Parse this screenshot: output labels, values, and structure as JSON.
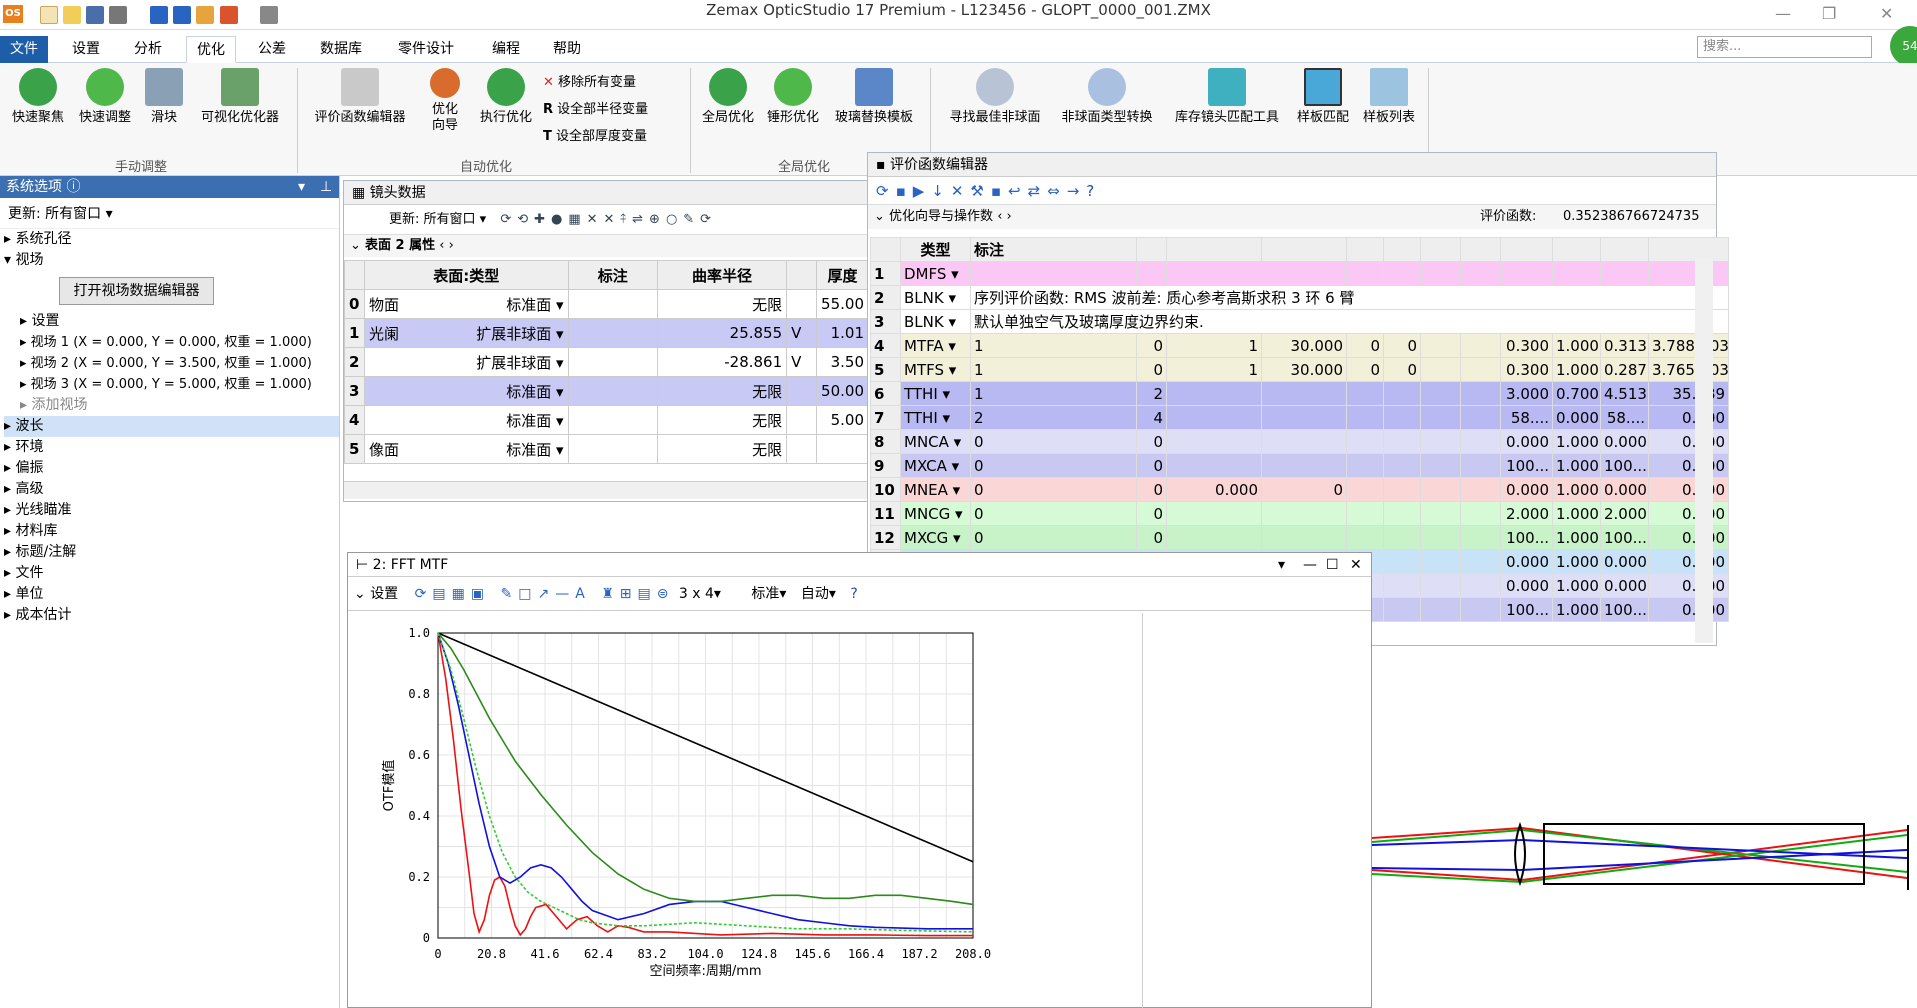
{
  "app": {
    "title": "Zemax OpticStudio 17    Premium - L123456 - GLOPT_0000_001.ZMX",
    "icon": "OS"
  },
  "tabs": [
    "文件",
    "设置",
    "分析",
    "优化",
    "公差",
    "数据库",
    "零件设计",
    "编程",
    "帮助"
  ],
  "search": {
    "placeholder": "搜索..."
  },
  "avatar": "54",
  "ribbon": {
    "manual": {
      "label": "手动调整",
      "buttons": [
        "快速聚焦",
        "快速调整",
        "滑块",
        "可视化优化器"
      ]
    },
    "auto": {
      "label": "自动优化",
      "buttons": [
        "评价函数编辑器",
        "优化\n向导",
        "执行优化"
      ],
      "small": [
        "移除所有变量",
        "设全部半径变量",
        "设全部厚度变量"
      ]
    },
    "global": {
      "label": "全局优化",
      "buttons": [
        "全局优化",
        "锤形优化",
        "玻璃替换模板"
      ]
    },
    "tools": {
      "buttons": [
        "寻找最佳非球面",
        "非球面类型转换",
        "库存镜头匹配工具",
        "样板匹配",
        "样板列表"
      ]
    }
  },
  "sidebar": {
    "title": "系统选项",
    "update": "更新: 所有窗口",
    "items": [
      "系统孔径",
      "视场"
    ],
    "button": "打开视场数据编辑器",
    "fields": [
      "设置",
      "视场 1 (X = 0.000, Y = 0.000, 权重 = 1.000)",
      "视场 2 (X = 0.000, Y = 3.500, 权重 = 1.000)",
      "视场 3 (X = 0.000, Y = 5.000, 权重 = 1.000)",
      "添加视场"
    ],
    "items2": [
      "波长",
      "环境",
      "偏振",
      "高级",
      "光线瞄准",
      "材料库",
      "标题/注解",
      "文件",
      "单位",
      "成本估计"
    ]
  },
  "lens": {
    "title": "镜头数据",
    "update": "更新: 所有窗口",
    "props": "表面 2 属性",
    "headers": [
      "",
      "表面:类型",
      "",
      "标注",
      "曲率半径",
      "",
      "厚度"
    ],
    "rows": [
      {
        "n": "0",
        "name": "物面",
        "type": "标准面",
        "r": "无限",
        "f": "",
        "t": "55.00"
      },
      {
        "n": "1",
        "name": "光阑",
        "type": "扩展非球面",
        "r": "25.855",
        "f": "V",
        "t": "1.01"
      },
      {
        "n": "2",
        "name": "",
        "type": "扩展非球面",
        "r": "-28.861",
        "f": "V",
        "t": "3.50"
      },
      {
        "n": "3",
        "name": "",
        "type": "标准面",
        "r": "无限",
        "f": "",
        "t": "50.00"
      },
      {
        "n": "4",
        "name": "",
        "type": "标准面",
        "r": "无限",
        "f": "",
        "t": "5.00"
      },
      {
        "n": "5",
        "name": "像面",
        "type": "标准面",
        "r": "无限",
        "f": "",
        "t": ""
      }
    ]
  },
  "merit": {
    "title": "评价函数编辑器",
    "wizard": "优化向导与操作数",
    "mf_label": "评价函数:",
    "mf_value": "0.352386766724735",
    "headers": [
      "",
      "类型",
      "标注"
    ],
    "rows": [
      {
        "n": "1",
        "type": "DMFS",
        "c": [
          "",
          "",
          "",
          "",
          "",
          "",
          "",
          "",
          "",
          "",
          "",
          ""
        ]
      },
      {
        "n": "2",
        "type": "BLNK",
        "span": "序列评价函数: RMS 波前差: 质心参考高斯求积 3 环 6 臂"
      },
      {
        "n": "3",
        "type": "BLNK",
        "span": "默认单独空气及玻璃厚度边界约束."
      },
      {
        "n": "4",
        "type": "MTFA",
        "c": [
          "1",
          "0",
          "1",
          "30.000",
          "0",
          "0",
          "",
          "",
          "0.300",
          "1.000",
          "0.313",
          "3.788E-03"
        ]
      },
      {
        "n": "5",
        "type": "MTFS",
        "c": [
          "1",
          "0",
          "1",
          "30.000",
          "0",
          "0",
          "",
          "",
          "0.300",
          "1.000",
          "0.287",
          "3.765E-03"
        ]
      },
      {
        "n": "6",
        "type": "TTHI",
        "c": [
          "1",
          "2",
          "",
          "",
          "",
          "",
          "",
          "",
          "3.000",
          "0.700",
          "4.513",
          "35.989"
        ]
      },
      {
        "n": "7",
        "type": "TTHI",
        "c": [
          "2",
          "4",
          "",
          "",
          "",
          "",
          "",
          "",
          "58....",
          "0.000",
          "58....",
          "0.000"
        ]
      },
      {
        "n": "8",
        "type": "MNCA",
        "c": [
          "0",
          "0",
          "",
          "",
          "",
          "",
          "",
          "",
          "0.000",
          "1.000",
          "0.000",
          "0.000"
        ]
      },
      {
        "n": "9",
        "type": "MXCA",
        "c": [
          "0",
          "0",
          "",
          "",
          "",
          "",
          "",
          "",
          "100...",
          "1.000",
          "100...",
          "0.000"
        ]
      },
      {
        "n": "10",
        "type": "MNEA",
        "c": [
          "0",
          "0",
          "0.000",
          "0",
          "",
          "",
          "",
          "",
          "0.000",
          "1.000",
          "0.000",
          "0.000"
        ]
      },
      {
        "n": "11",
        "type": "MNCG",
        "c": [
          "0",
          "0",
          "",
          "",
          "",
          "",
          "",
          "",
          "2.000",
          "1.000",
          "2.000",
          "0.000"
        ]
      },
      {
        "n": "12",
        "type": "MXCG",
        "c": [
          "0",
          "0",
          "",
          "",
          "",
          "",
          "",
          "",
          "100...",
          "1.000",
          "100...",
          "0.000"
        ]
      },
      {
        "n": "13",
        "type": "",
        "c": [
          "",
          "",
          "",
          "",
          "",
          "",
          "",
          "",
          "0.000",
          "1.000",
          "0.000",
          "0.000"
        ]
      },
      {
        "n": "14",
        "type": "",
        "c": [
          "",
          "",
          "",
          "",
          "",
          "",
          "",
          "",
          "0.000",
          "1.000",
          "0.000",
          "0.000"
        ]
      },
      {
        "n": "15",
        "type": "",
        "c": [
          "",
          "",
          "",
          "",
          "",
          "",
          "",
          "",
          "100...",
          "1.000",
          "100...",
          "0.000"
        ]
      }
    ]
  },
  "mtf": {
    "title": "2: FFT MTF",
    "settings": "设置",
    "layout": "3 x 4",
    "std": "标准",
    "auto": "自动"
  },
  "chart_data": {
    "type": "line",
    "xlabel": "空间频率:周期/mm",
    "ylabel": "OTF模值",
    "xticks": [
      "0",
      "20.8",
      "41.6",
      "62.4",
      "83.2",
      "104.0",
      "124.8",
      "145.6",
      "166.4",
      "187.2",
      "208.0"
    ],
    "yticks": [
      "0",
      "0.2",
      "0.4",
      "0.6",
      "0.8",
      "1.0"
    ],
    "xlim": [
      0,
      208
    ],
    "ylim": [
      0,
      1
    ],
    "colors": {
      "diffraction": "#000000",
      "red": "#ee1111",
      "blue": "#1111dd",
      "green": "#2a8a1a",
      "lgreen": "#33cc33"
    },
    "series": [
      {
        "color": "diffraction",
        "x": [
          0,
          208
        ],
        "y": [
          1,
          0.25
        ]
      },
      {
        "color": "red",
        "x": [
          0,
          3,
          6,
          9,
          12,
          14,
          16,
          18,
          20,
          22,
          24,
          26,
          28,
          30,
          32,
          34,
          36,
          38,
          42,
          46,
          50,
          54,
          58,
          62,
          66,
          70,
          74,
          80,
          90,
          100,
          110,
          130,
          150,
          170,
          190,
          208
        ],
        "y": [
          1,
          0.85,
          0.65,
          0.42,
          0.22,
          0.08,
          0.02,
          0.06,
          0.14,
          0.19,
          0.2,
          0.17,
          0.1,
          0.04,
          0.01,
          0.03,
          0.07,
          0.1,
          0.11,
          0.07,
          0.03,
          0.06,
          0.07,
          0.04,
          0.02,
          0.04,
          0.035,
          0.02,
          0.02,
          0.015,
          0.01,
          0.015,
          0.01,
          0.01,
          0.008,
          0.008
        ]
      },
      {
        "color": "blue",
        "x": [
          0,
          4,
          8,
          12,
          16,
          20,
          24,
          28,
          32,
          36,
          40,
          44,
          48,
          52,
          56,
          60,
          70,
          80,
          90,
          100,
          110,
          120,
          130,
          140,
          150,
          160,
          170,
          190,
          208
        ],
        "y": [
          1,
          0.9,
          0.76,
          0.6,
          0.44,
          0.3,
          0.2,
          0.18,
          0.2,
          0.23,
          0.24,
          0.23,
          0.2,
          0.16,
          0.12,
          0.09,
          0.06,
          0.08,
          0.11,
          0.12,
          0.12,
          0.1,
          0.08,
          0.06,
          0.05,
          0.04,
          0.035,
          0.03,
          0.03
        ]
      },
      {
        "color": "green",
        "x": [
          0,
          5,
          10,
          15,
          20,
          30,
          40,
          50,
          60,
          70,
          80,
          90,
          100,
          110,
          120,
          130,
          140,
          150,
          160,
          170,
          180,
          190,
          200,
          208
        ],
        "y": [
          1,
          0.95,
          0.88,
          0.8,
          0.72,
          0.58,
          0.47,
          0.37,
          0.28,
          0.21,
          0.16,
          0.13,
          0.12,
          0.12,
          0.13,
          0.14,
          0.14,
          0.13,
          0.13,
          0.14,
          0.14,
          0.13,
          0.12,
          0.11
        ]
      },
      {
        "color": "lgreen",
        "x": [
          0,
          5,
          10,
          15,
          20,
          25,
          30,
          35,
          40,
          45,
          50,
          55,
          60,
          70,
          80,
          90,
          100,
          120,
          140,
          160,
          180,
          208
        ],
        "y": [
          1,
          0.88,
          0.72,
          0.55,
          0.4,
          0.28,
          0.2,
          0.15,
          0.12,
          0.1,
          0.08,
          0.06,
          0.05,
          0.04,
          0.04,
          0.045,
          0.05,
          0.04,
          0.03,
          0.03,
          0.025,
          0.02
        ]
      }
    ]
  }
}
